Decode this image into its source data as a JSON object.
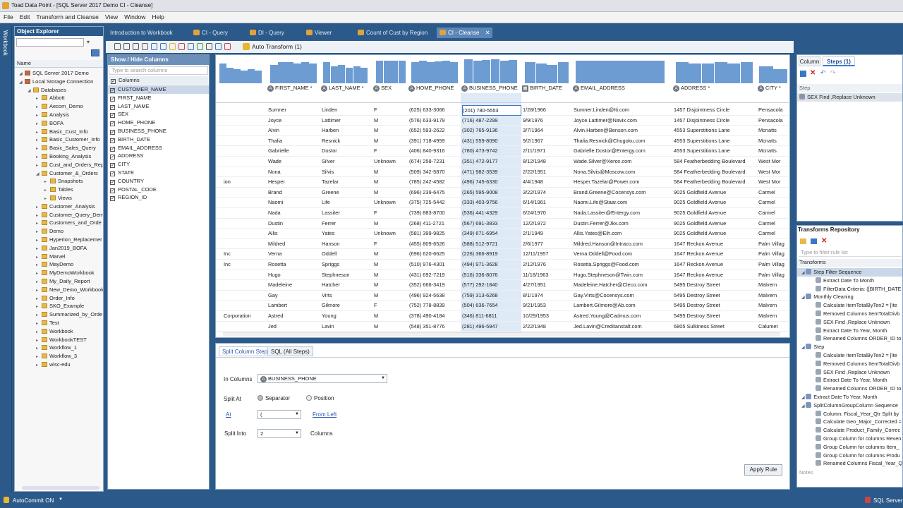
{
  "window": {
    "title": "Toad Data Point - [SQL Server 2017 Demo CI - Cleanse]"
  },
  "menu": [
    "File",
    "Edit",
    "Transform and Cleanse",
    "View",
    "Window",
    "Help"
  ],
  "sidebar_strip": "Workbook",
  "explorer": {
    "title": "Object Explorer",
    "name_header": "Name",
    "nodes": [
      "SQL Server 2017 Demo",
      "Local Storage Connection",
      "Databases",
      "Abbott",
      "Aecom_Demo",
      "Analysis",
      "BOFA",
      "Basic_Cust_Info",
      "Basic_Customer_Info",
      "Basic_Sales_Query",
      "Booking_Analysis",
      "Cust_and_Orders_Rep",
      "Customer_&_Orders",
      "Snapshots",
      "Tables",
      "Views",
      "Customer_Analysis",
      "Customer_Query_Dem",
      "Customers_and_Orde",
      "Demo",
      "Hyperion_Replacemer",
      "Jan2019_BOFA",
      "Marvel",
      "MayDemo",
      "MyDemoWorkbook",
      "My_Daily_Report",
      "New_Demo_Workbook",
      "Order_Info",
      "SKO_Example",
      "Summarized_by_Orde",
      "Test",
      "Workbook",
      "WorkbookTEST",
      "Workflow_1",
      "Workflow_3",
      "wisc-edu"
    ]
  },
  "tabs": [
    "Introduction to Workbook",
    "CI - Query",
    "DI - Query",
    "Viewer",
    "Count of Cust by Region",
    "CI - Cleanse"
  ],
  "toolbar": {
    "auto_transform": "Auto Transform (1)"
  },
  "columns_panel": {
    "title": "Show / Hide Columns",
    "search_placeholder": "Type to search columns",
    "group": "Columns",
    "items": [
      "CUSTOMER_NAME",
      "FIRST_NAME",
      "LAST_NAME",
      "SEX",
      "HOME_PHONE",
      "BUSINESS_PHONE",
      "BIRTH_DATE",
      "EMAIL_ADDRESS",
      "ADDRESS",
      "CITY",
      "STATE",
      "COUNTRY",
      "POSTAL_CODE",
      "REGION_ID"
    ]
  },
  "grid": {
    "headers": [
      "FIRST_NAME *",
      "LAST_NAME *",
      "SEX",
      "HOME_PHONE",
      "BUSINESS_PHONE",
      "BIRTH_DATE",
      "EMAIL_ADDRESS",
      "ADDRESS *",
      "CITY *"
    ],
    "rows": [
      [
        "",
        "Sumner",
        "Linden",
        "F",
        "(625) 633-3066",
        "(201) 780-5553",
        "1/28/1966",
        "Sumner.Linden@Iti.com",
        "1457 Disjointness Circle",
        "Pensacola"
      ],
      [
        "",
        "Joyce",
        "Lattimer",
        "M",
        "(576) 633-9179",
        "(716) 487-2299",
        "9/9/1976",
        "Joyce.Lattimer@Navix.com",
        "1457 Disjointness Circle",
        "Pensacola"
      ],
      [
        "",
        "Alvin",
        "Harben",
        "M",
        "(652) 593-2622",
        "(302) 765-9136",
        "3/7/1964",
        "Alvin.Harben@Benson.com",
        "4553 Superstitions Lane",
        "Mcnatts"
      ],
      [
        "",
        "Thalia",
        "Resnick",
        "M",
        "(391) 718-4959",
        "(431) 559-8090",
        "9/2/1967",
        "Thalia.Resnick@Chugoku.com",
        "4553 Superstitions Lane",
        "Mcnatts"
      ],
      [
        "",
        "Gabrielle",
        "Dostor",
        "F",
        "(406) 840-9316",
        "(780) 473-9742",
        "2/11/1971",
        "Gabrielle.Dostor@Entergy.com",
        "4553 Superstitions Lane",
        "Mcnatts"
      ],
      [
        "",
        "Wade",
        "Silver",
        "Unknown",
        "(674) 258-7231",
        "(351) 472-9177",
        "8/12/1948",
        "Wade.Silver@Xerox.com",
        "584 Featherbedding Boulevard",
        "West Mor"
      ],
      [
        "",
        "Nona",
        "Silvis",
        "M",
        "(509) 342-5870",
        "(471) 982-3539",
        "2/22/1951",
        "Nona.Silvis@Moscow.com",
        "584 Featherbedding Boulevard",
        "West Mor"
      ],
      [
        "ion",
        "Hesper",
        "Tazelar",
        "M",
        "(785) 242-4582",
        "(496) 745-6330",
        "4/4/1948",
        "Hesper.Tazelar@Power.com",
        "584 Featherbedding Boulevard",
        "West Mor"
      ],
      [
        "",
        "Brand",
        "Greene",
        "M",
        "(696) 239-6475",
        "(265) 595-9008",
        "3/22/1974",
        "Brand.Greene@Cocensys.com",
        "9025 Goldfield Avenue",
        "Carmel"
      ],
      [
        "",
        "Naomi",
        "Life",
        "Unknown",
        "(375) 725-5442",
        "(333) 403-9756",
        "6/14/1961",
        "Naomi.Life@Staar.com",
        "9025 Goldfield Avenue",
        "Carmel"
      ],
      [
        "",
        "Nada",
        "Lassiter",
        "F",
        "(739) 883-8700",
        "(536) 441-4329",
        "6/24/1970",
        "Nada.Lassiter@Entergy.com",
        "9025 Goldfield Avenue",
        "Carmel"
      ],
      [
        "",
        "Dustin",
        "Ferrer",
        "M",
        "(268) 411-2721",
        "(567) 691-3833",
        "12/2/1972",
        "Dustin.Ferrer@Jkx.com",
        "9025 Goldfield Avenue",
        "Carmel"
      ],
      [
        "",
        "Allis",
        "Yates",
        "Unknown",
        "(581) 399-9825",
        "(349) 671-6954",
        "2/1/1949",
        "Allis.Yates@Eih.com",
        "9025 Goldfield Avenue",
        "Carmel"
      ],
      [
        "",
        "Mildred",
        "Hanson",
        "F",
        "(455) 809-6526",
        "(588) 512-9721",
        "2/6/1977",
        "Mildred.Hanson@Intraco.com",
        "1647 Reckon Avenue",
        "Palm Villag"
      ],
      [
        "Inc",
        "Verna",
        "Oddell",
        "M",
        "(696) 620-6625",
        "(226) 366-8919",
        "12/11/1957",
        "Verna.Oddell@Food.com",
        "1647 Reckon Avenue",
        "Palm Villag"
      ],
      [
        "Inc",
        "Rosetta",
        "Spriggs",
        "M",
        "(510) 976-4301",
        "(494) 971-3628",
        "2/12/1976",
        "Rosetta.Spriggs@Food.com",
        "1647 Reckon Avenue",
        "Palm Villag"
      ],
      [
        "",
        "Hugo",
        "Stephneson",
        "M",
        "(431) 692-7219",
        "(516) 336-8076",
        "11/18/1963",
        "Hugo.Stephneson@Twin.com",
        "1647 Reckon Avenue",
        "Palm Villag"
      ],
      [
        "",
        "Madeleine",
        "Hatcher",
        "M",
        "(352) 666-3419",
        "(577) 292-1840",
        "4/27/1951",
        "Madeleine.Hatcher@Cleco.com",
        "5495 Destroy Street",
        "Malvern"
      ],
      [
        "",
        "Gay",
        "Virts",
        "M",
        "(496) 924-5638",
        "(759) 313-6268",
        "8/1/1974",
        "Gay.Virts@Cocensys.com",
        "5495 Destroy Street",
        "Malvern"
      ],
      [
        "",
        "Lambert",
        "Gilmore",
        "F",
        "(752) 778-8839",
        "(504) 636-7654",
        "9/21/1953",
        "Lambert.Gilmore@Ab.com",
        "5495 Destroy Street",
        "Malvern"
      ],
      [
        "Corporation",
        "Astred",
        "Young",
        "M",
        "(378) 490-4184",
        "(346) 811-6811",
        "10/29/1953",
        "Astred.Young@Cadmus.com",
        "5495 Destroy Street",
        "Malvern"
      ],
      [
        "",
        "Jed",
        "Lavin",
        "M",
        "(548) 351-8776",
        "(281) 496-5947",
        "2/22/1948",
        "Jed.Lavin@Creditanstalt.com",
        "6805 Sulkiness Street",
        "Calumet"
      ]
    ]
  },
  "split_panel": {
    "tabs": [
      "Split Column Step",
      "SQL (All Steps)"
    ],
    "in_columns_label": "In Columns",
    "in_columns_value": "BUSINESS_PHONE",
    "split_at_label": "Split At",
    "separator": "Separator",
    "position": "Position",
    "at_label": "At",
    "at_value": "(",
    "from_left": "From Left",
    "split_into_label": "Split Into",
    "split_into_value": "2",
    "columns_label": "Columns",
    "apply": "Apply Rule"
  },
  "steps_panel": {
    "tabs": [
      "Column",
      "Steps (1)"
    ],
    "step_header": "Step",
    "steps": [
      "SEX Find ,Replace Unknown"
    ]
  },
  "repo": {
    "title": "Transforms Repository",
    "filter_placeholder": "Type to filter rule list",
    "transforms_label": "Transforms",
    "notes": "Notes",
    "items": [
      {
        "t": "Step Filter Sequence",
        "l": 1,
        "hl": true
      },
      {
        "t": "Extract Date To Month",
        "l": 2
      },
      {
        "t": "FilterData Criteria: ([BIRTH_DATE",
        "l": 2
      },
      {
        "t": "Monthly Cleaning",
        "l": 1
      },
      {
        "t": "Calculate ItemTotalByTen2 = [Ite",
        "l": 2
      },
      {
        "t": "Removed Columns ItemTotalDivb",
        "l": 2
      },
      {
        "t": "SEX Find ,Replace Unknown",
        "l": 2
      },
      {
        "t": "Extract Date To Year, Month",
        "l": 2
      },
      {
        "t": "Renamed Columns ORDER_ID to",
        "l": 2
      },
      {
        "t": "Step",
        "l": 1
      },
      {
        "t": "Calculate ItemTotalByTen2 = [Ite",
        "l": 2
      },
      {
        "t": "Removed Columns ItemTotalDivb",
        "l": 2
      },
      {
        "t": "SEX Find ,Replace Unknown",
        "l": 2
      },
      {
        "t": "Extract Date To Year, Month",
        "l": 2
      },
      {
        "t": "Renamed Columns ORDER_ID to",
        "l": 2
      },
      {
        "t": "Extract Date To Year, Month",
        "l": 1
      },
      {
        "t": "SplitColumnGroupColumn Sequence",
        "l": 1
      },
      {
        "t": "Column: Fiscal_Year_Qtr Split by",
        "l": 2
      },
      {
        "t": "Calculate Geo_Major_Corrected =",
        "l": 2
      },
      {
        "t": "Calculate Product_Family_Correc",
        "l": 2
      },
      {
        "t": "Group Column for columns Reven",
        "l": 2
      },
      {
        "t": "Group Column for columns Item_",
        "l": 2
      },
      {
        "t": "Group Column for columns Produ",
        "l": 2
      },
      {
        "t": "Renamed Columns Fiscal_Year_Q",
        "l": 2
      }
    ]
  },
  "status": {
    "autocommit": "AutoCommit ON",
    "server": "SQL Server"
  }
}
